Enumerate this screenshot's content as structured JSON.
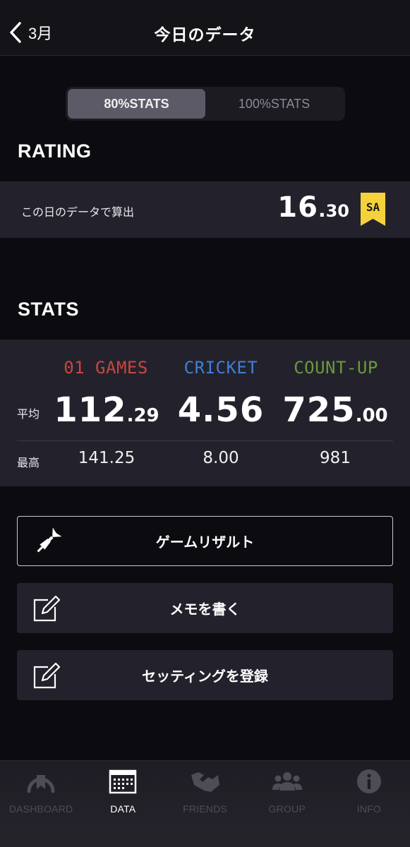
{
  "header": {
    "back_label": "3月",
    "title": "今日のデータ"
  },
  "stats_mode": {
    "options": [
      "80%STATS",
      "100%STATS"
    ],
    "selected": "80%STATS"
  },
  "rating": {
    "section_title": "RATING",
    "caption": "この日のデータで算出",
    "value_int": "16",
    "value_dot": ".",
    "value_dec": "30",
    "rank": "SA",
    "rank_color": "#f5d23c"
  },
  "stats": {
    "section_title": "STATS",
    "row_labels": {
      "average": "平均",
      "best": "最高"
    },
    "columns": [
      {
        "name": "01 GAMES",
        "color": "#c9463f",
        "avg_int": "112",
        "avg_dec": ".29",
        "best": "141.25"
      },
      {
        "name": "CRICKET",
        "color": "#3f7fd9",
        "avg_int": "4.56",
        "avg_dec": "",
        "best": "8.00"
      },
      {
        "name": "COUNT-UP",
        "color": "#6a9a3c",
        "avg_int": "725",
        "avg_dec": ".00",
        "best": "981"
      }
    ]
  },
  "actions": {
    "game_result": "ゲームリザルト",
    "write_memo": "メモを書く",
    "register_setting": "セッティングを登録"
  },
  "tabbar": {
    "items": [
      {
        "label": "DASHBOARD",
        "icon": "dashboard-icon",
        "active": false
      },
      {
        "label": "DATA",
        "icon": "calendar-icon",
        "active": true
      },
      {
        "label": "FRIENDS",
        "icon": "handshake-icon",
        "active": false
      },
      {
        "label": "GROUP",
        "icon": "group-icon",
        "active": false
      },
      {
        "label": "INFO",
        "icon": "info-icon",
        "active": false
      }
    ]
  }
}
